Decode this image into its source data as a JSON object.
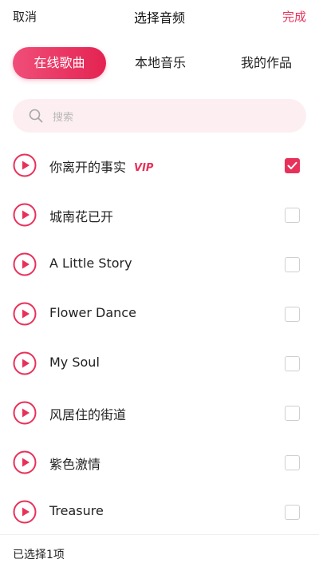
{
  "header": {
    "cancel": "取消",
    "title": "选择音频",
    "done": "完成"
  },
  "tabs": [
    {
      "label": "在线歌曲",
      "active": true
    },
    {
      "label": "本地音乐",
      "active": false
    },
    {
      "label": "我的作品",
      "active": false
    }
  ],
  "search": {
    "placeholder": "搜索",
    "icon": "search-icon"
  },
  "songs": [
    {
      "title": "你离开的事实",
      "badge": "VIP",
      "checked": true
    },
    {
      "title": "城南花已开",
      "checked": false
    },
    {
      "title": "A Little Story",
      "checked": false
    },
    {
      "title": "Flower Dance",
      "checked": false
    },
    {
      "title": "My Soul",
      "checked": false
    },
    {
      "title": "风居住的街道",
      "checked": false
    },
    {
      "title": "紫色激情",
      "checked": false
    },
    {
      "title": "Treasure",
      "checked": false
    }
  ],
  "footer": {
    "selected_text": "已选择1项"
  },
  "colors": {
    "accent": "#e8315a",
    "search_bg": "#fdeef1",
    "checkbox_border": "#cfcfcf"
  }
}
